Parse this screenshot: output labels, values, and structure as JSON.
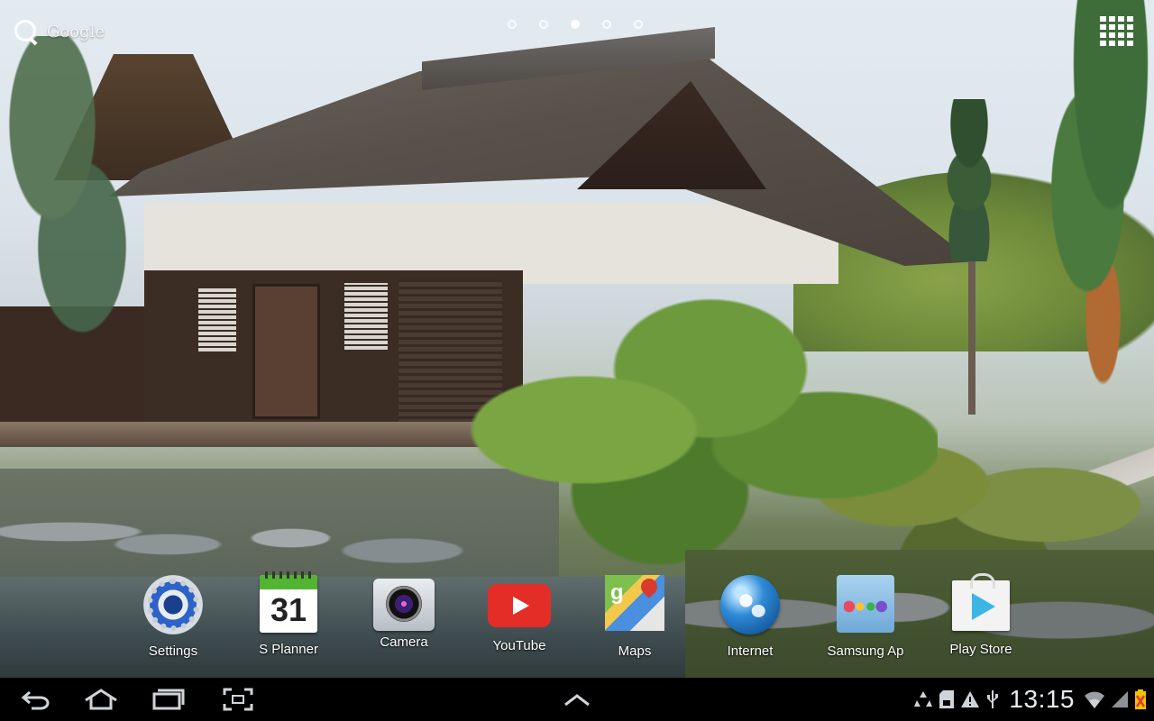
{
  "top": {
    "search_label": "Google",
    "pages": [
      false,
      false,
      true,
      false,
      false
    ]
  },
  "dock": {
    "apps": [
      {
        "label": "Settings",
        "icon": "gear-icon"
      },
      {
        "label": "S Planner",
        "icon": "calendar-icon",
        "badge": "31"
      },
      {
        "label": "Camera",
        "icon": "camera-icon"
      },
      {
        "label": "YouTube",
        "icon": "youtube-icon"
      },
      {
        "label": "Maps",
        "icon": "map-icon"
      },
      {
        "label": "Internet",
        "icon": "globe-icon"
      },
      {
        "label": "Samsung Ap",
        "icon": "samsung-apps-icon"
      },
      {
        "label": "Play Store",
        "icon": "play-store-icon"
      }
    ]
  },
  "system_bar": {
    "nav": [
      "back-icon",
      "home-icon",
      "recent-apps-icon",
      "screenshot-icon",
      "up-arrow-icon"
    ],
    "status_icons": [
      "recycle-icon",
      "sd-card-icon",
      "warning-icon",
      "usb-icon",
      "wifi-icon",
      "signal-icon",
      "battery-icon"
    ],
    "clock": "13:15"
  },
  "colors": {
    "youtube_red": "#e52d27",
    "planner_green": "#52b433",
    "battery_red": "#e53935",
    "battery_yellow": "#f2c400"
  }
}
